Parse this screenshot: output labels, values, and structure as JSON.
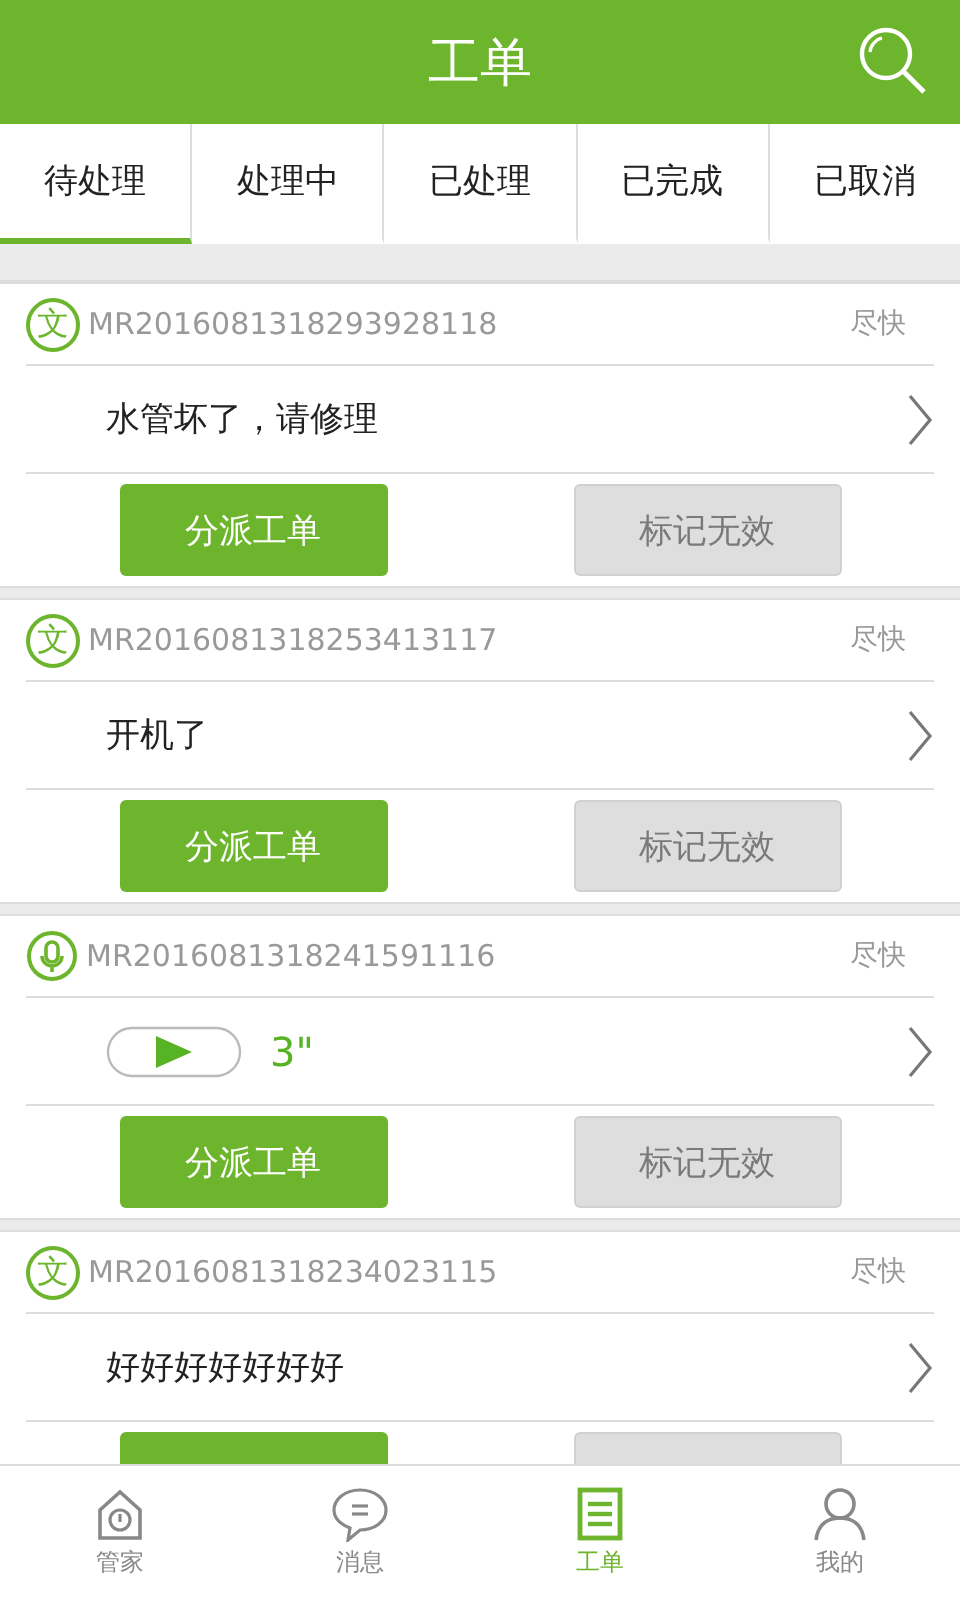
{
  "header": {
    "title": "工单"
  },
  "tabs": [
    {
      "label": "待处理",
      "selected": true
    },
    {
      "label": "处理中",
      "selected": false
    },
    {
      "label": "已处理",
      "selected": false
    },
    {
      "label": "已完成",
      "selected": false
    },
    {
      "label": "已取消",
      "selected": false
    }
  ],
  "orders": [
    {
      "kind": "text",
      "badge": "文",
      "number": "MR2016081318293928118",
      "priority": "尽快",
      "content": "水管坏了，请修理",
      "buttons": [
        {
          "label": "分派工单",
          "disabled": false
        },
        {
          "label": "标记无效",
          "disabled": true
        }
      ]
    },
    {
      "kind": "text",
      "badge": "文",
      "number": "MR2016081318253413117",
      "priority": "尽快",
      "content": "开机了",
      "buttons": [
        {
          "label": "分派工单",
          "disabled": false
        },
        {
          "label": "标记无效",
          "disabled": true
        }
      ]
    },
    {
      "kind": "voice",
      "number": "MR2016081318241591116",
      "priority": "尽快",
      "duration": "3\"",
      "buttons": [
        {
          "label": "分派工单",
          "disabled": false
        },
        {
          "label": "标记无效",
          "disabled": true
        }
      ]
    },
    {
      "kind": "text",
      "badge": "文",
      "number": "MR2016081318234023115",
      "priority": "尽快",
      "content": "好好好好好好好",
      "buttons": [
        {
          "disabled": false
        },
        {
          "disabled": true
        }
      ]
    }
  ],
  "nav": [
    {
      "kind": "home",
      "label": "管家",
      "selected": false
    },
    {
      "kind": "message",
      "label": "消息",
      "selected": false
    },
    {
      "kind": "orders",
      "label": "工单",
      "selected": true
    },
    {
      "kind": "profile",
      "label": "我的",
      "selected": false
    }
  ]
}
